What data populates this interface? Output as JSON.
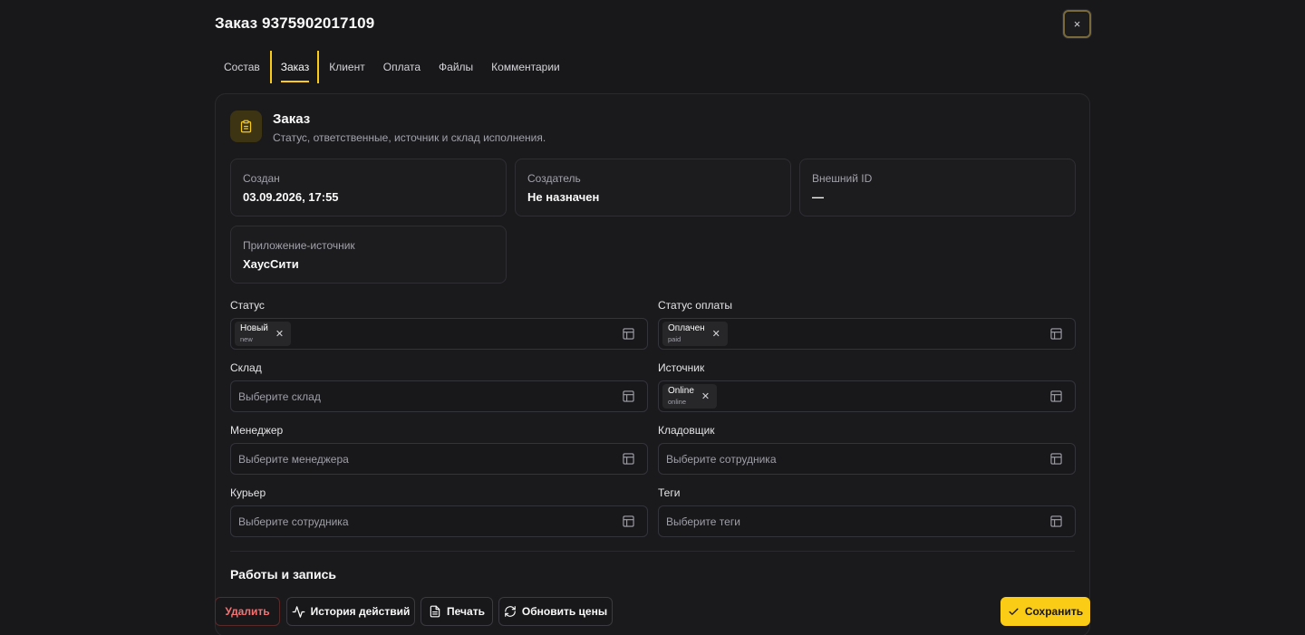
{
  "modal": {
    "title": "Заказ 9375902017109",
    "close_label": "×"
  },
  "tabs": [
    {
      "label": "Состав",
      "active": false
    },
    {
      "label": "Заказ",
      "active": true
    },
    {
      "label": "Клиент",
      "active": false
    },
    {
      "label": "Оплата",
      "active": false
    },
    {
      "label": "Файлы",
      "active": false
    },
    {
      "label": "Комментарии",
      "active": false
    }
  ],
  "section": {
    "icon": "clipboard-icon",
    "title": "Заказ",
    "subtitle": "Статус, ответственные, источник и склад исполнения."
  },
  "info": {
    "created": {
      "label": "Создан",
      "value": "03.09.2026, 17:55"
    },
    "creator": {
      "label": "Создатель",
      "value": "Не назначен"
    },
    "external_id": {
      "label": "Внешний ID",
      "value": "—"
    },
    "source_app": {
      "label": "Приложение-источник",
      "value": "ХаусСити"
    }
  },
  "fields": {
    "status": {
      "label": "Статус",
      "chip_main": "Новый",
      "chip_code": "new"
    },
    "payment_status": {
      "label": "Статус оплаты",
      "chip_main": "Оплачен",
      "chip_code": "paid"
    },
    "warehouse": {
      "label": "Склад",
      "placeholder": "Выберите склад"
    },
    "source": {
      "label": "Источник",
      "chip_main": "Online",
      "chip_code": "online"
    },
    "manager": {
      "label": "Менеджер",
      "placeholder": "Выберите менеджера"
    },
    "storekeeper": {
      "label": "Кладовщик",
      "placeholder": "Выберите сотрудника"
    },
    "courier": {
      "label": "Курьер",
      "placeholder": "Выберите сотрудника"
    },
    "tags": {
      "label": "Теги",
      "placeholder": "Выберите теги"
    }
  },
  "works": {
    "title": "Работы и запись"
  },
  "footer": {
    "delete": "Удалить",
    "history": "История действий",
    "print": "Печать",
    "update_prices": "Обновить цены",
    "save": "Сохранить"
  },
  "colors": {
    "accent": "#facc15",
    "danger": "#f87171",
    "background": "#18181b"
  }
}
